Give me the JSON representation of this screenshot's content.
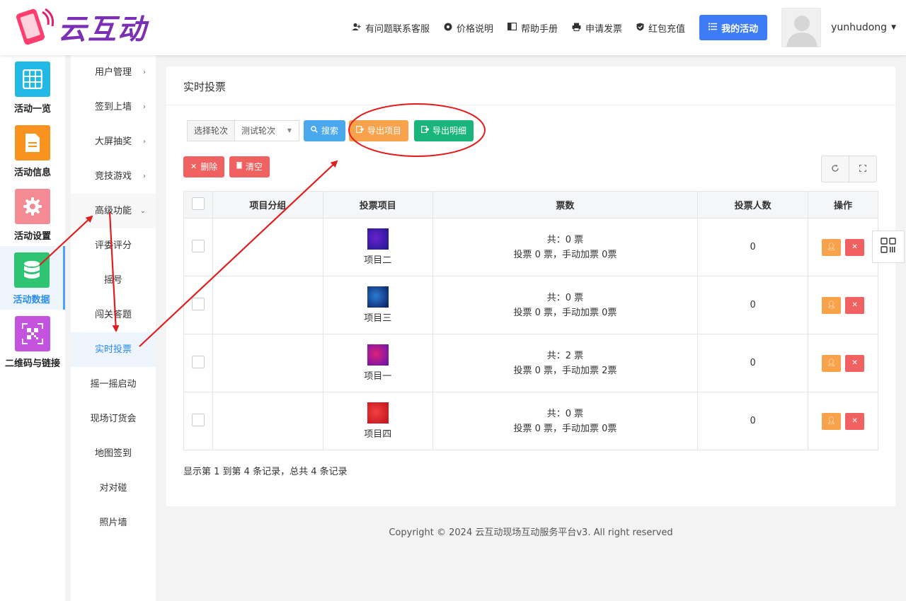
{
  "brand": {
    "name": "云互动"
  },
  "topnav": {
    "items": [
      {
        "label": "有问题联系客服",
        "icon": "person-plus-icon"
      },
      {
        "label": "价格说明",
        "icon": "gear-icon"
      },
      {
        "label": "帮助手册",
        "icon": "book-icon"
      },
      {
        "label": "申请发票",
        "icon": "printer-icon"
      },
      {
        "label": "红包充值",
        "icon": "shield-check-icon"
      }
    ],
    "my_activity": "我的活动",
    "username": "yunhudong"
  },
  "iconcol": [
    {
      "label": "活动一览",
      "color": "#22b8e6",
      "icon": "grid-icon"
    },
    {
      "label": "活动信息",
      "color": "#f7931e",
      "icon": "document-icon"
    },
    {
      "label": "活动设置",
      "color": "#f48a93",
      "icon": "gear-icon"
    },
    {
      "label": "活动数据",
      "color": "#2fc473",
      "icon": "database-icon",
      "active": true
    },
    {
      "label": "二维码与链接",
      "color": "#c653e0",
      "icon": "qrcode-icon"
    }
  ],
  "submenu": [
    {
      "label": "用户管理",
      "arrow": "›"
    },
    {
      "label": "签到上墙",
      "arrow": "›"
    },
    {
      "label": "大屏抽奖",
      "arrow": "›"
    },
    {
      "label": "竞技游戏",
      "arrow": "›"
    },
    {
      "label": "高级功能",
      "arrow": "⌄"
    },
    {
      "label": "评委评分"
    },
    {
      "label": "摇号"
    },
    {
      "label": "闯关答题"
    },
    {
      "label": "实时投票",
      "active": true
    },
    {
      "label": "摇一摇启动"
    },
    {
      "label": "现场订货会"
    },
    {
      "label": "地图签到"
    },
    {
      "label": "对对碰"
    },
    {
      "label": "照片墙"
    }
  ],
  "panel": {
    "title": "实时投票",
    "filter_label": "选择轮次",
    "round_value": "测试轮次",
    "btn_search": "搜索",
    "btn_export_items": "导出项目",
    "btn_export_detail": "导出明细",
    "btn_delete": "删除",
    "btn_clear": "清空"
  },
  "table": {
    "headers": [
      "项目分组",
      "投票项目",
      "票数",
      "投票人数",
      "操作"
    ],
    "rows": [
      {
        "group": "",
        "item": "项目二",
        "total": "共：0 票",
        "detail": "投票 0 票，手动加票 0票",
        "voters": "0",
        "thumb": [
          "#6a1fd0",
          "#1a1a8a"
        ]
      },
      {
        "group": "",
        "item": "项目三",
        "total": "共：0 票",
        "detail": "投票 0 票，手动加票 0票",
        "voters": "0",
        "thumb": [
          "#2b7bd6",
          "#0a1a55"
        ]
      },
      {
        "group": "",
        "item": "项目一",
        "total": "共：2 票",
        "detail": "投票 0 票，手动加票 2票",
        "voters": "0",
        "thumb": [
          "#e0207a",
          "#5a14b0"
        ]
      },
      {
        "group": "",
        "item": "项目四",
        "total": "共：0 票",
        "detail": "投票 0 票，手动加票 0票",
        "voters": "0",
        "thumb": [
          "#f04040",
          "#c0101a"
        ]
      }
    ]
  },
  "records": "显示第 1 到第 4 条记录，总共 4 条记录",
  "footer": "Copyright © 2024 云互动现场互动服务平台v3. All right reserved",
  "colors": {
    "accent": "#3d7cf5",
    "annotation": "#e11d1d"
  }
}
